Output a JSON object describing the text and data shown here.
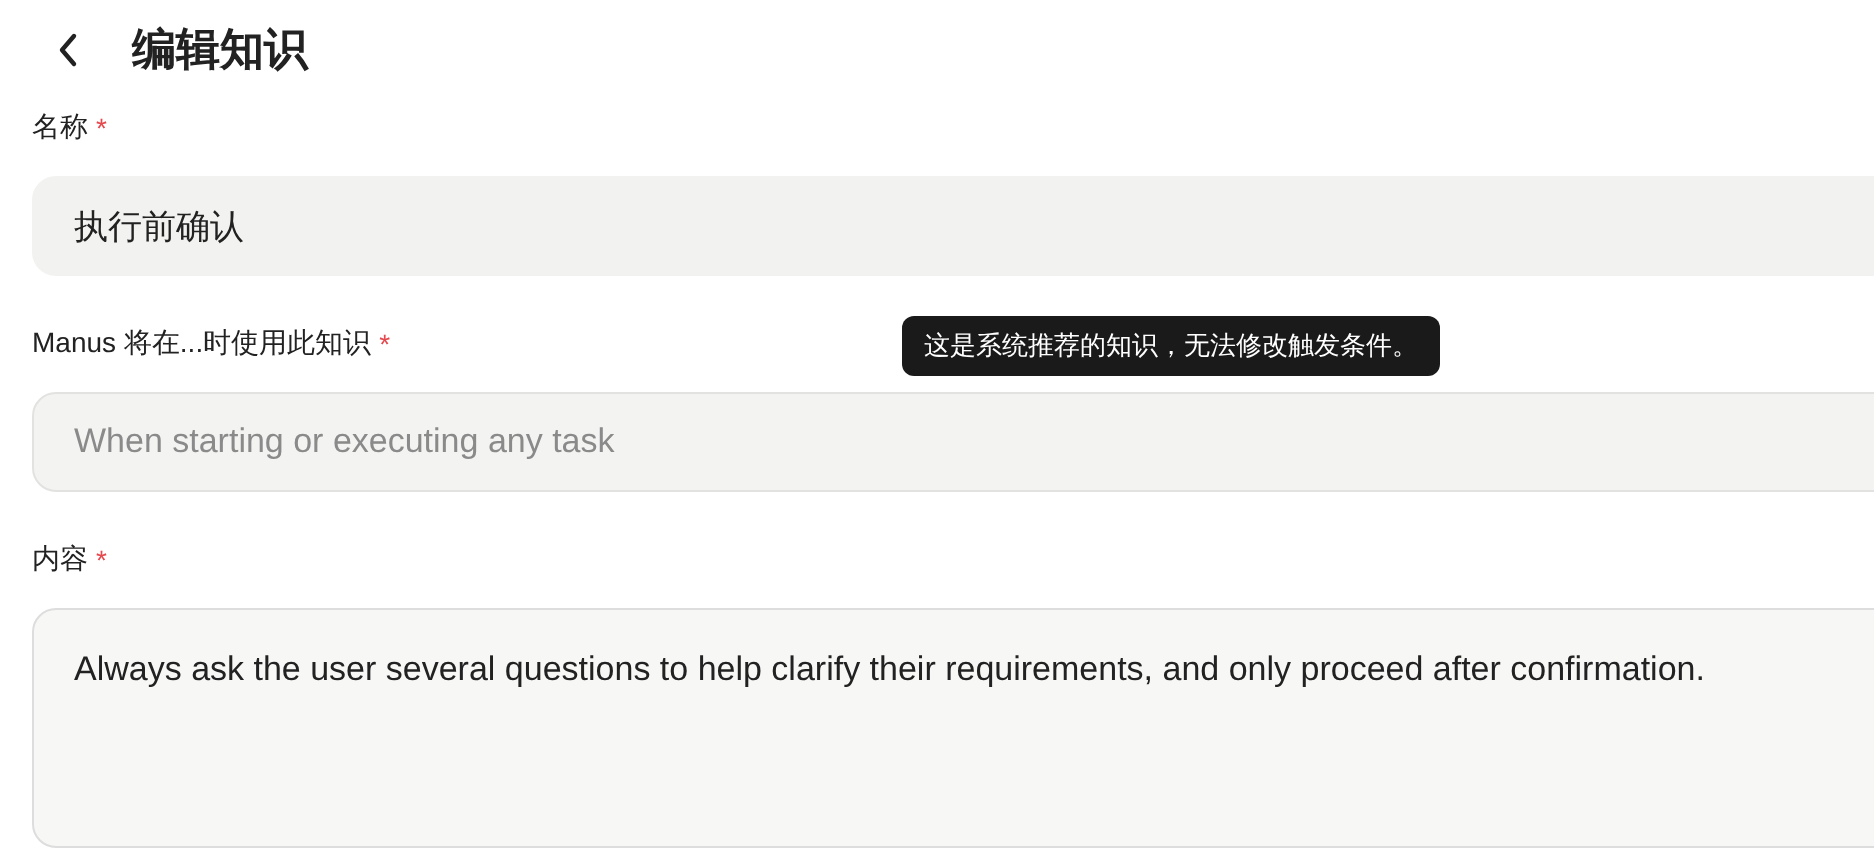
{
  "header": {
    "title": "编辑知识"
  },
  "fields": [
    {
      "kind": "input",
      "label": "名称",
      "required_mark": "*",
      "value": "执行前确认",
      "disabled": false
    },
    {
      "kind": "input",
      "label": "Manus 将在...时使用此知识",
      "required_mark": "*",
      "placeholder": "When starting or executing any task",
      "disabled": true,
      "tooltip": "这是系统推荐的知识，无法修改触发条件。"
    },
    {
      "kind": "textarea",
      "label": "内容",
      "required_mark": "*",
      "value": "Always ask the user several questions to help clarify their requirements, and only proceed after confirmation.",
      "disabled": false
    }
  ]
}
